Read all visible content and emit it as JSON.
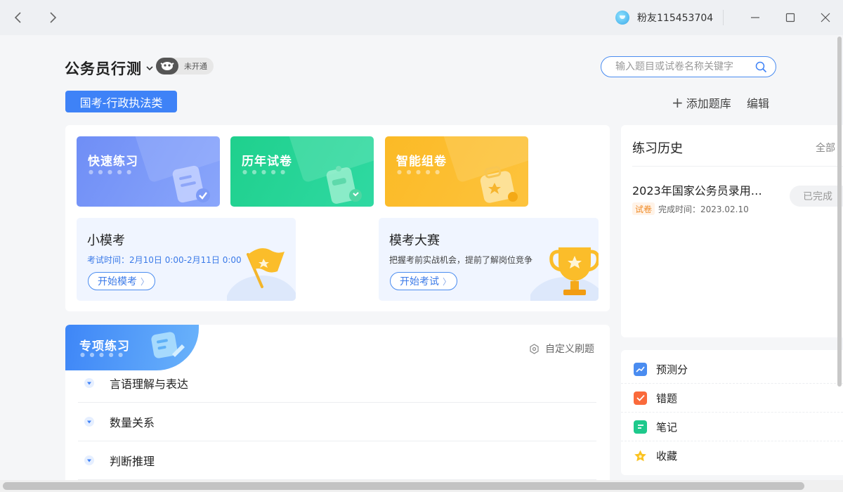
{
  "window": {
    "user_name": "粉友115453704",
    "icons": [
      "back-icon",
      "forward-icon",
      "avatar",
      "minimize-icon",
      "maximize-icon",
      "close-icon"
    ]
  },
  "header": {
    "subject": "公务员行测",
    "badge_label": "未开通",
    "search_placeholder": "输入题目或试卷名称关键字",
    "category_tab": "国考-行政执法类",
    "add_bank_icon": "+",
    "add_bank_label": "添加题库",
    "edit_label": "编辑"
  },
  "features": [
    {
      "label": "快速练习",
      "dots": "● ● ● ● ●",
      "color": "#6b8ff5",
      "icon": "quick-practice-icon"
    },
    {
      "label": "历年试卷",
      "dots": "● ● ● ● ●",
      "color": "#26cf93",
      "icon": "past-papers-icon"
    },
    {
      "label": "智能组卷",
      "dots": "● ● ● ● ●",
      "color": "#fbb51f",
      "icon": "smart-paper-icon"
    }
  ],
  "mini_exam": {
    "title": "小模考",
    "desc": "考试时间：2月10日 0:00-2月11日 0:00",
    "button": "开始模考",
    "arrow": "〉"
  },
  "competition": {
    "title": "模考大赛",
    "desc": "把握考前实战机会，提前了解岗位竞争",
    "button": "开始考试",
    "arrow": "〉"
  },
  "special": {
    "title": "专项练习",
    "dots": "● ● ● ● ●",
    "custom_label": "自定义刷题",
    "topics": [
      "言语理解与表达",
      "数量关系",
      "判断推理"
    ]
  },
  "history": {
    "title": "练习历史",
    "all_label": "全部",
    "item_title": "2023年国家公务员录用考…",
    "item_tag": "试卷",
    "item_time": "完成时间：2023.02.10",
    "item_status": "已完成"
  },
  "tools": [
    {
      "label": "预测分",
      "color": "#4a8cf0",
      "icon": "forecast-icon"
    },
    {
      "label": "错题",
      "color": "#fa6a3b",
      "icon": "mistakes-icon"
    },
    {
      "label": "笔记",
      "color": "#1ec98c",
      "icon": "notes-icon"
    },
    {
      "label": "收藏",
      "color": "#fbc21f",
      "icon": "favorites-icon"
    }
  ],
  "colors": {
    "accent": "#3e82f7",
    "quick": "#6b8ff5",
    "past": "#26cf93",
    "smart": "#fbb51f",
    "tag_orange": "#f08a24"
  }
}
